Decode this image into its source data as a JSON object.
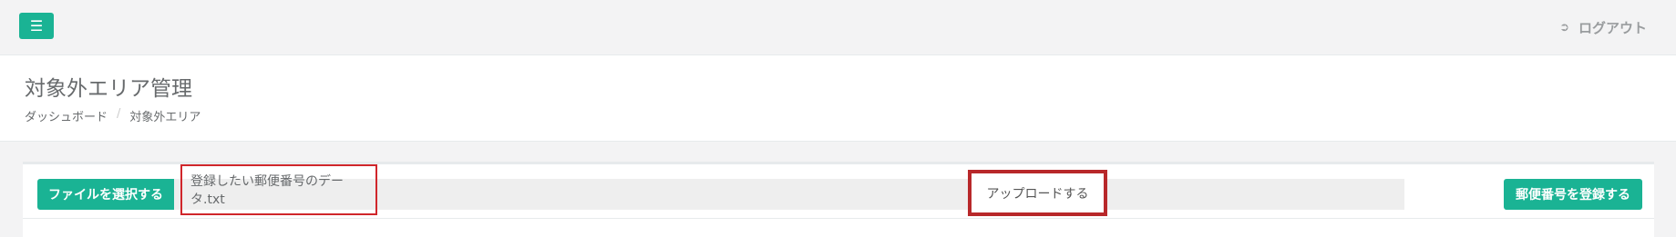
{
  "topbar": {
    "menu_icon": "hamburger-icon",
    "logout_icon": "sign-out-icon",
    "logout_label": "ログアウト"
  },
  "heading": {
    "title": "対象外エリア管理",
    "breadcrumb": [
      "ダッシュボード",
      "対象外エリア"
    ],
    "separator": "/"
  },
  "upload": {
    "choose_file_label": "ファイルを選択する",
    "file_name": "登録したい郵便番号のデータ.txt",
    "upload_label": "アップロードする",
    "register_label": "郵便番号を登録する"
  },
  "colors": {
    "accent": "#1ab394",
    "highlight_red": "#b8282a"
  }
}
